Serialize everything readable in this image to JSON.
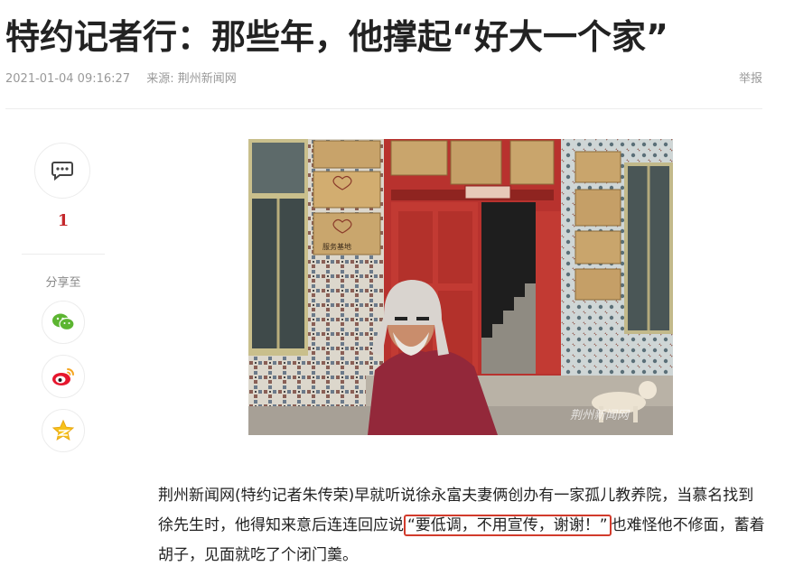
{
  "article": {
    "title": "特约记者行：那些年，他撑起“好大一个家”",
    "datetime": "2021-01-04 09:16:27",
    "source": "来源: 荆州新闻网",
    "report_label": "举报"
  },
  "sidebar": {
    "comment_count": "1",
    "share_label": "分享至",
    "share_items": [
      {
        "icon": "wechat-icon"
      },
      {
        "icon": "weibo-icon"
      },
      {
        "icon": "qzone-icon"
      }
    ]
  },
  "photo": {
    "sign_text": "",
    "plaque_text": "服务基地",
    "watermark": "荆州新闻网"
  },
  "body": {
    "text_before": "荆州新闻网(特约记者朱传荣)早就听说徐永富夫妻俩创办有一家孤儿教养院，当慕名找到徐先生时，他得知来意后连连回应说",
    "quote": "“要低调，不用宣传，谢谢！”",
    "text_after": "也难怪他不修面，蓄着胡子，见面就吃了个闭门羹。"
  },
  "colors": {
    "accent": "#c4282c",
    "highlight_border": "#d23b2c",
    "meta": "#999999"
  }
}
